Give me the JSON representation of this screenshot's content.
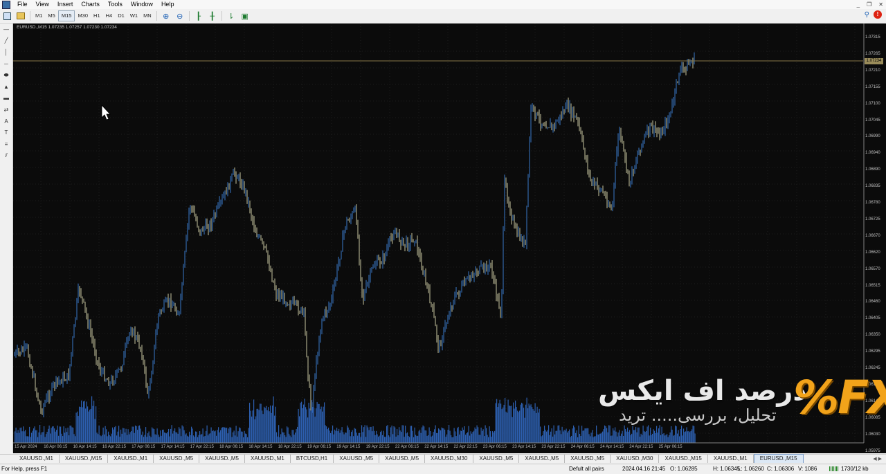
{
  "menubar": {
    "items": [
      "File",
      "View",
      "Insert",
      "Charts",
      "Tools",
      "Window",
      "Help"
    ]
  },
  "toolbar": {
    "timeframes": [
      "M1",
      "M5",
      "M15",
      "M30",
      "H1",
      "H4",
      "D1",
      "W1",
      "MN"
    ],
    "active_timeframe": "M15"
  },
  "chart": {
    "header": "EURUSD.,M15  1.07235 1.07257 1.07230 1.07234",
    "current_price": "1.07234",
    "background": "#0b0b0b",
    "up_color": "#3a78c9",
    "down_color": "#c9c7a0",
    "volume_color": "#2d5fb0",
    "price_axis": [
      "1.07315",
      "1.07265",
      "1.07210",
      "1.07155",
      "1.07100",
      "1.07045",
      "1.06990",
      "1.06940",
      "1.06890",
      "1.06835",
      "1.06780",
      "1.06725",
      "1.06670",
      "1.06620",
      "1.06570",
      "1.06515",
      "1.06460",
      "1.06405",
      "1.06350",
      "1.06295",
      "1.06245",
      "1.06190",
      "1.06140",
      "1.06085",
      "1.06030",
      "1.05975"
    ],
    "time_axis": [
      "15 Apr 2024",
      "16 Apr 06:15",
      "16 Apr 14:15",
      "16 Apr 22:15",
      "17 Apr 06:15",
      "17 Apr 14:15",
      "17 Apr 22:15",
      "18 Apr 06:15",
      "18 Apr 14:15",
      "18 Apr 22:15",
      "19 Apr 06:15",
      "19 Apr 14:15",
      "19 Apr 22:15",
      "22 Apr 06:15",
      "22 Apr 14:15",
      "22 Apr 22:15",
      "23 Apr 06:15",
      "23 Apr 14:15",
      "23 Apr 22:15",
      "24 Apr 06:15",
      "24 Apr 14:15",
      "24 Apr 22:15",
      "25 Apr 06:15"
    ]
  },
  "watermark": {
    "title": "درصد اف ایکس",
    "subtitle": "تحلیل، بررسی..... ترید",
    "brand": "%FX"
  },
  "tabs": {
    "items": [
      "XAUUSD.,M1",
      "XAUUSD.,M15",
      "XAUUSD.,M1",
      "XAUUSD.,M5",
      "XAUUSD.,M5",
      "XAUUSD.,M1",
      "BTCUSD,H1",
      "XAUUSD.,M5",
      "XAUUSD.,M5",
      "XAUUSD.,M30",
      "XAUUSD.,M5",
      "XAUUSD.,M5",
      "XAUUSD.,M5",
      "XAUUSD.,M30",
      "XAUUSD.,M15",
      "XAUUSD.,M1",
      "EURUSD.,M15"
    ],
    "active_index": 16
  },
  "status": {
    "help": "For Help, press F1",
    "profile": "Defult all pairs",
    "datetime": "2024.04.16 21:45",
    "open": "O: 1.06285",
    "high": "H: 1.06345",
    "low": "L: 1.06260",
    "close": "C: 1.06306",
    "volume": "V: 1086",
    "traffic": "1730/12 kb"
  }
}
